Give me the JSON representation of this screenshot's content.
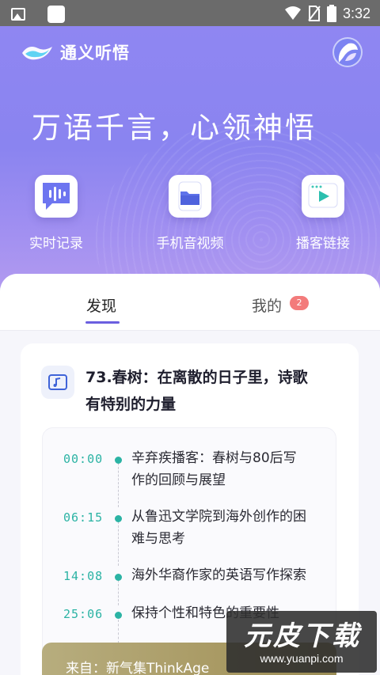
{
  "status_bar": {
    "time": "3:32"
  },
  "header": {
    "app_name": "通义听悟",
    "slogan": "万语千言，心领神悟"
  },
  "quick_actions": [
    {
      "label": "实时记录",
      "icon": "waveform-icon"
    },
    {
      "label": "手机音视频",
      "icon": "folder-icon"
    },
    {
      "label": "播客链接",
      "icon": "play-icon"
    }
  ],
  "tabs": [
    {
      "label": "发现",
      "active": true
    },
    {
      "label": "我的",
      "badge": "2"
    }
  ],
  "card": {
    "title_line1": "73.春树：在离散的日子里，诗歌",
    "title_line2": "有特别的力量",
    "chapters": [
      {
        "time": "00:00",
        "line1": "辛弃疾播客：春树与80后写",
        "line2": "作的回顾与展望"
      },
      {
        "time": "06:15",
        "line1": "从鲁迅文学院到海外创作的困",
        "line2": "难与思考"
      },
      {
        "time": "14:08",
        "line1": "海外华裔作家的英语写作探索",
        "line2": ""
      },
      {
        "time": "25:06",
        "line1": "保持个性和特色的重要性",
        "line2": ""
      }
    ],
    "source": "来自：新气集ThinkAge"
  },
  "watermark": {
    "title": "元皮下载",
    "url": "www.yuanpi.com"
  },
  "colors": {
    "accent": "#6b5fe0",
    "timeline": "#2bb3a4",
    "badge": "#f37b7b"
  }
}
